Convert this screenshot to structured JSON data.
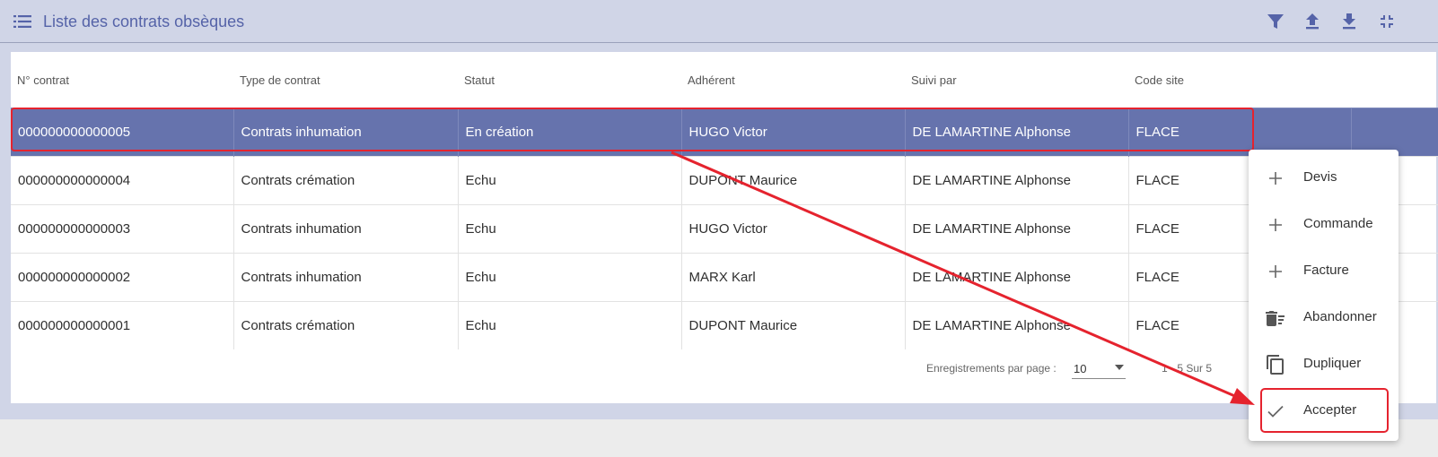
{
  "header": {
    "title": "Liste des contrats obsèques",
    "icons": [
      "menu-icon",
      "filter-icon",
      "upload-icon",
      "download-icon",
      "collapse-icon"
    ]
  },
  "table": {
    "columns": [
      "N° contrat",
      "Type de contrat",
      "Statut",
      "Adhérent",
      "Suivi par",
      "Code site"
    ],
    "rows": [
      [
        "000000000000005",
        "Contrats inhumation",
        "En création",
        "HUGO Victor",
        "DE LAMARTINE Alphonse",
        "FLACE"
      ],
      [
        "000000000000004",
        "Contrats crémation",
        "Echu",
        "DUPONT Maurice",
        "DE LAMARTINE Alphonse",
        "FLACE"
      ],
      [
        "000000000000003",
        "Contrats inhumation",
        "Echu",
        "HUGO Victor",
        "DE LAMARTINE Alphonse",
        "FLACE"
      ],
      [
        "000000000000002",
        "Contrats inhumation",
        "Echu",
        "MARX Karl",
        "DE LAMARTINE Alphonse",
        "FLACE"
      ],
      [
        "000000000000001",
        "Contrats crémation",
        "Echu",
        "DUPONT Maurice",
        "DE LAMARTINE Alphonse",
        "FLACE"
      ]
    ],
    "selected_row": 0
  },
  "pager": {
    "label": "Enregistrements par page :",
    "per_page": "10",
    "range": "1 - 5 Sur 5"
  },
  "context_menu": {
    "items": [
      {
        "label": "Devis",
        "icon": "plus-icon"
      },
      {
        "label": "Commande",
        "icon": "plus-icon"
      },
      {
        "label": "Facture",
        "icon": "plus-icon"
      },
      {
        "label": "Abandonner",
        "icon": "delete-sweep-icon"
      },
      {
        "label": "Dupliquer",
        "icon": "copy-icon"
      },
      {
        "label": "Accepter",
        "icon": "check-icon"
      }
    ]
  },
  "colors": {
    "accent": "#5563a8",
    "selected_row": "#6673ad",
    "annotation": "#e5232e",
    "panel": "#d0d5e7"
  }
}
